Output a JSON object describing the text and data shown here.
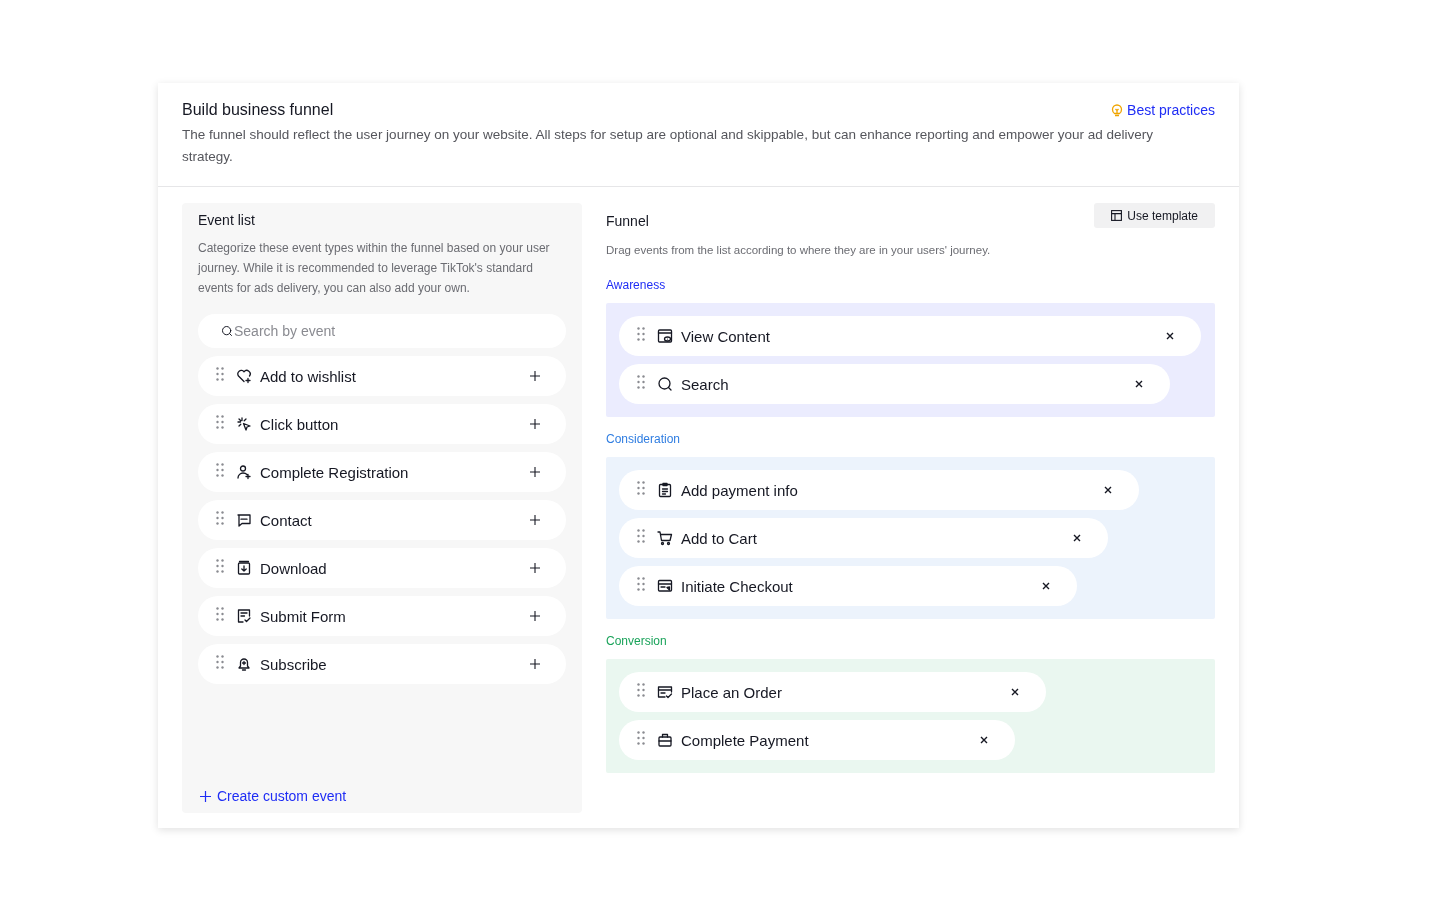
{
  "header": {
    "title": "Build business funnel",
    "link": "Best practices",
    "description": "The funnel should reflect the user journey on your website. All steps for setup are optional and skippable, but can enhance reporting and empower your ad delivery strategy."
  },
  "event_list": {
    "title": "Event list",
    "description": "Categorize these event types within the funnel based on your user journey. While it is recommended to leverage TikTok's standard events for ads delivery, you can also add your own.",
    "search": {
      "placeholder": "Search by event"
    },
    "items": [
      {
        "label": "Add to wishlist"
      },
      {
        "label": "Click button"
      },
      {
        "label": "Complete Registration"
      },
      {
        "label": "Contact"
      },
      {
        "label": "Download"
      },
      {
        "label": "Submit Form"
      },
      {
        "label": "Subscribe"
      }
    ],
    "create_link": "Create custom event"
  },
  "funnel": {
    "title": "Funnel",
    "button": "Use template",
    "description": "Drag events from the list according to where they are in your users' journey.",
    "stages": [
      {
        "name": "Awareness",
        "color": "#1f2df5",
        "events": [
          {
            "label": "View Content"
          },
          {
            "label": "Search"
          }
        ]
      },
      {
        "name": "Consideration",
        "color": "#2f7de1",
        "events": [
          {
            "label": "Add payment info"
          },
          {
            "label": "Add to Cart"
          },
          {
            "label": "Initiate Checkout"
          }
        ]
      },
      {
        "name": "Conversion",
        "color": "#1aa35a",
        "events": [
          {
            "label": "Place an Order"
          },
          {
            "label": "Complete Payment"
          }
        ]
      }
    ]
  }
}
